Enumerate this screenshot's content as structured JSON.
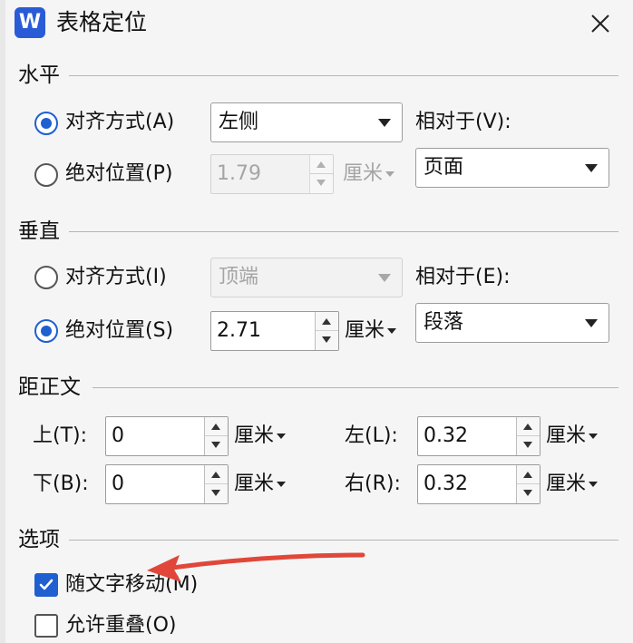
{
  "app": {
    "icon_letter": "W",
    "title": "表格定位",
    "close_icon": "close-icon"
  },
  "horizontal": {
    "group_label": "水平",
    "align_radio": {
      "label": "对齐方式(A)",
      "checked": true
    },
    "align_select": {
      "value": "左侧"
    },
    "relative_label": "相对于(V):",
    "relative_select": {
      "value": "页面"
    },
    "absolute_radio": {
      "label": "绝对位置(P)",
      "checked": false
    },
    "position_value": "1.79",
    "position_unit": "厘米"
  },
  "vertical": {
    "group_label": "垂直",
    "align_radio": {
      "label": "对齐方式(I)",
      "checked": false
    },
    "align_select": {
      "value": "顶端"
    },
    "relative_label": "相对于(E):",
    "relative_select": {
      "value": "段落"
    },
    "absolute_radio": {
      "label": "绝对位置(S)",
      "checked": true
    },
    "position_value": "2.71",
    "position_unit": "厘米"
  },
  "distance": {
    "group_label": "距正文",
    "top": {
      "label": "上(T):",
      "value": "0",
      "unit": "厘米"
    },
    "bottom": {
      "label": "下(B):",
      "value": "0",
      "unit": "厘米"
    },
    "left": {
      "label": "左(L):",
      "value": "0.32",
      "unit": "厘米"
    },
    "right": {
      "label": "右(R):",
      "value": "0.32",
      "unit": "厘米"
    }
  },
  "options": {
    "group_label": "选项",
    "move_with_text": {
      "label": "随文字移动(M)",
      "checked": true
    },
    "allow_overlap": {
      "label": "允许重叠(O)",
      "checked": false
    }
  },
  "colors": {
    "accent": "#1f5fcf",
    "annotation_arrow": "#e0473a",
    "app_icon": "#2a5bd7"
  }
}
